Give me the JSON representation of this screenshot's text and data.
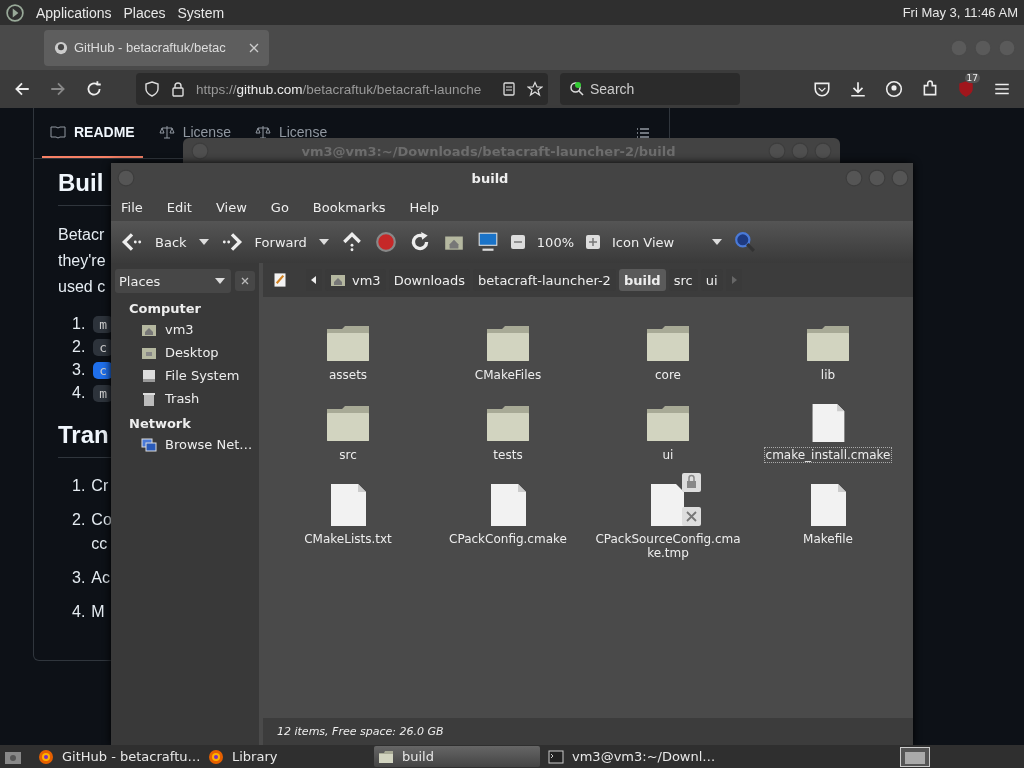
{
  "top_panel": {
    "menus": [
      "Applications",
      "Places",
      "System"
    ],
    "clock": "Fri May 3, 11:46 AM"
  },
  "browser": {
    "tab": {
      "title": "GitHub - betacraftuk/betac",
      "selected": true
    },
    "url": {
      "prefix": "https://",
      "domain": "github.com",
      "path": "/betacraftuk/betacraft-launche"
    },
    "search": {
      "placeholder": "Search"
    },
    "extension_badge": "17"
  },
  "readme": {
    "tabs": [
      {
        "label": "README",
        "selected": true
      },
      {
        "label": "License",
        "selected": false
      },
      {
        "label": "License",
        "selected": false
      }
    ],
    "heading_1": "Buil",
    "paragraph_lines": [
      "Betacr",
      "they're",
      "used c"
    ],
    "code_list": [
      {
        "number": "1.",
        "code": "m",
        "highlighted": false
      },
      {
        "number": "2.",
        "code": "c",
        "highlighted": false
      },
      {
        "number": "3.",
        "code": "c",
        "highlighted": true
      },
      {
        "number": "4.",
        "code": "m",
        "highlighted": false
      }
    ],
    "heading_2": "Tran",
    "steps": [
      {
        "number": "1.",
        "lines": [
          "Cr"
        ]
      },
      {
        "number": "2.",
        "lines": [
          "Co",
          "cc"
        ]
      },
      {
        "number": "3.",
        "lines": [
          "Ac"
        ]
      },
      {
        "number": "4.",
        "lines": [
          "M"
        ]
      }
    ]
  },
  "terminal_window": {
    "title": "vm3@vm3:~/Downloads/betacraft-launcher-2/build"
  },
  "file_manager": {
    "title": "build",
    "menu": [
      "File",
      "Edit",
      "View",
      "Go",
      "Bookmarks",
      "Help"
    ],
    "toolbar": {
      "back": "Back",
      "forward": "Forward",
      "zoom": "100%",
      "view": "Icon View"
    },
    "sidebar": {
      "title": "Places",
      "sections": [
        {
          "heading": "Computer",
          "items": [
            {
              "label": "vm3",
              "kind": "home"
            },
            {
              "label": "Desktop",
              "kind": "desktop"
            },
            {
              "label": "File System",
              "kind": "drive"
            },
            {
              "label": "Trash",
              "kind": "trash"
            }
          ]
        },
        {
          "heading": "Network",
          "items": [
            {
              "label": "Browse Net…",
              "kind": "network"
            }
          ]
        }
      ]
    },
    "breadcrumbs": [
      {
        "label": "vm3",
        "selected": false
      },
      {
        "label": "Downloads",
        "selected": false
      },
      {
        "label": "betacraft-launcher-2",
        "selected": false
      },
      {
        "label": "build",
        "selected": true
      },
      {
        "label": "src",
        "selected": false
      },
      {
        "label": "ui",
        "selected": false
      }
    ],
    "files": [
      {
        "name": "assets",
        "kind": "folder",
        "focused": false
      },
      {
        "name": "CMakeFiles",
        "kind": "folder",
        "focused": false
      },
      {
        "name": "core",
        "kind": "folder",
        "focused": false
      },
      {
        "name": "lib",
        "kind": "folder",
        "focused": false
      },
      {
        "name": "src",
        "kind": "folder",
        "focused": false
      },
      {
        "name": "tests",
        "kind": "folder",
        "focused": false
      },
      {
        "name": "ui",
        "kind": "folder",
        "focused": false
      },
      {
        "name": "cmake_install.cmake",
        "kind": "file",
        "focused": true
      },
      {
        "name": "CMakeLists.txt",
        "kind": "file",
        "focused": false
      },
      {
        "name": "CPackConfig.cmake",
        "kind": "file",
        "focused": false
      },
      {
        "name": "CPackSourceConfig.cmake.tmp",
        "kind": "locked-file",
        "focused": false
      },
      {
        "name": "Makefile",
        "kind": "file",
        "focused": false
      }
    ],
    "status": "12 items, Free space: 26.0 GB"
  },
  "taskbar": [
    {
      "label": "GitHub - betacraftu…",
      "kind": "firefox",
      "selected": false
    },
    {
      "label": "Library",
      "kind": "firefox",
      "selected": false
    },
    {
      "label": "build",
      "kind": "folder",
      "selected": true
    },
    {
      "label": "vm3@vm3:~/Downl…",
      "kind": "terminal",
      "selected": false
    }
  ]
}
